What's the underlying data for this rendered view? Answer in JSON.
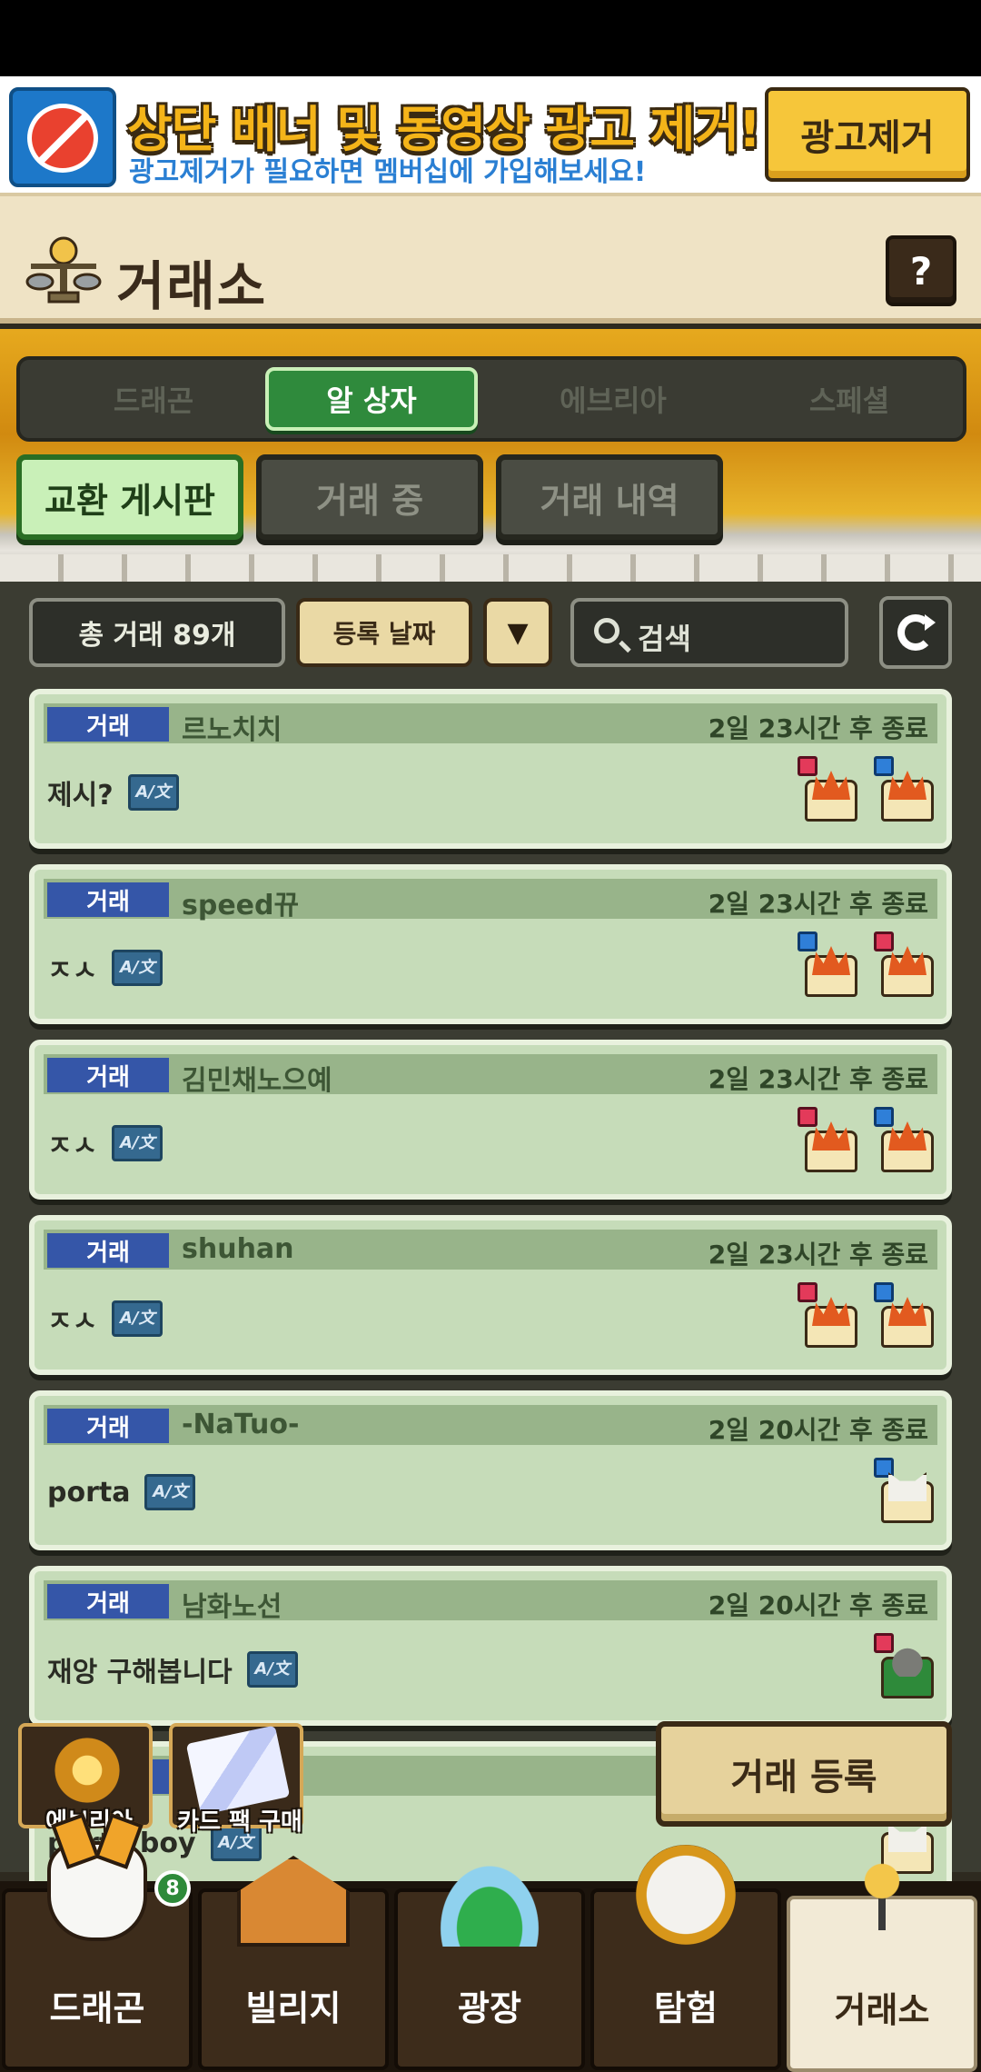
{
  "ad": {
    "title": "상단 배너 및 동영상 광고 제거!",
    "subtitle": "광고제거가 필요하면 멤버십에 가입해보세요!",
    "button": "광고제거"
  },
  "header": {
    "title": "거래소",
    "help": "?"
  },
  "categories": [
    "드래곤",
    "알 상자",
    "에브리아",
    "스페셜"
  ],
  "subtabs": [
    "교환 게시판",
    "거래 중",
    "거래 내역"
  ],
  "filters": {
    "total": "총 거래 89개",
    "sort": "등록 날짜",
    "sort_arrow": "▼",
    "search_placeholder": "검색"
  },
  "listings": [
    {
      "badge": "거래",
      "user": "르노치치",
      "time": "2일 23시간 후 종료",
      "message": "제시?",
      "eggs": [
        {
          "tag": "red",
          "kind": "fire"
        },
        {
          "tag": "blue",
          "kind": "fire"
        }
      ]
    },
    {
      "badge": "거래",
      "user": "speed뀨",
      "time": "2일 23시간 후 종료",
      "message": "ㅈㅅ",
      "eggs": [
        {
          "tag": "blue",
          "kind": "fire"
        },
        {
          "tag": "red",
          "kind": "fire"
        }
      ]
    },
    {
      "badge": "거래",
      "user": "김민채노으예",
      "time": "2일 23시간 후 종료",
      "message": "ㅈㅅ",
      "eggs": [
        {
          "tag": "red",
          "kind": "fire"
        },
        {
          "tag": "blue",
          "kind": "fire"
        }
      ]
    },
    {
      "badge": "거래",
      "user": "shuhan",
      "time": "2일 23시간 후 종료",
      "message": "ㅈㅅ",
      "eggs": [
        {
          "tag": "red",
          "kind": "fire"
        },
        {
          "tag": "blue",
          "kind": "fire"
        }
      ]
    },
    {
      "badge": "거래",
      "user": "-NaTuo-",
      "time": "2일 20시간 후 종료",
      "message": "porta",
      "eggs": [
        {
          "tag": "blue",
          "kind": "cat"
        }
      ]
    },
    {
      "badge": "거래",
      "user": "남화노선",
      "time": "2일 20시간 후 종료",
      "message": "재앙 구해봅니다",
      "eggs": [
        {
          "tag": "red",
          "kind": "gray"
        }
      ]
    },
    {
      "badge": "거래",
      "user": "",
      "time": "",
      "message": "porta boy",
      "eggs": [
        {
          "tag": "",
          "kind": "cat"
        }
      ]
    }
  ],
  "translate_icon": "A/文",
  "floating": {
    "everia": "에브리아",
    "card_pack": "카드 팩 구매",
    "register": "거래 등록"
  },
  "nav": {
    "items": [
      "드래곤",
      "빌리지",
      "광장",
      "탐험",
      "거래소"
    ],
    "badge": "8",
    "active": "거래소"
  }
}
